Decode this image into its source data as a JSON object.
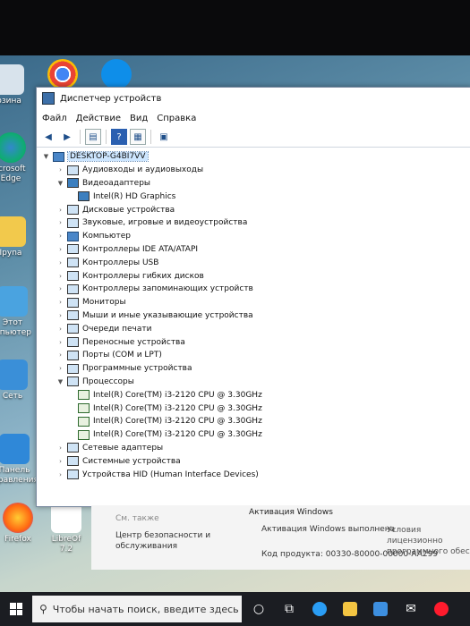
{
  "desktop": {
    "icons": [
      {
        "label": "рзина"
      },
      {
        "label": "icrosoft Edge"
      },
      {
        "label": "Ipyna"
      },
      {
        "label": "Этот мпьютер"
      },
      {
        "label": "Сеть"
      },
      {
        "label": "Панель правления"
      },
      {
        "label": "Firefox"
      },
      {
        "label": "LibreOf 7.2"
      }
    ]
  },
  "window": {
    "title": "Диспетчер устройств",
    "menu": [
      "Файл",
      "Действие",
      "Вид",
      "Справка"
    ],
    "tree": {
      "root": "DESKTOP-G4BI7VV",
      "items": [
        {
          "label": "Аудиовходы и аудиовыходы"
        },
        {
          "label": "Видеоадаптеры",
          "children": [
            "Intel(R) HD Graphics"
          ]
        },
        {
          "label": "Дисковые устройства"
        },
        {
          "label": "Звуковые, игровые и видеоустройства"
        },
        {
          "label": "Компьютер"
        },
        {
          "label": "Контроллеры IDE ATA/ATAPI"
        },
        {
          "label": "Контроллеры USB"
        },
        {
          "label": "Контроллеры гибких дисков"
        },
        {
          "label": "Контроллеры запоминающих устройств"
        },
        {
          "label": "Мониторы"
        },
        {
          "label": "Мыши и иные указывающие устройства"
        },
        {
          "label": "Очереди печати"
        },
        {
          "label": "Переносные устройства"
        },
        {
          "label": "Порты (COM и LPT)"
        },
        {
          "label": "Программные устройства"
        },
        {
          "label": "Процессоры",
          "children": [
            "Intel(R) Core(TM) i3-2120 CPU @ 3.30GHz",
            "Intel(R) Core(TM) i3-2120 CPU @ 3.30GHz",
            "Intel(R) Core(TM) i3-2120 CPU @ 3.30GHz",
            "Intel(R) Core(TM) i3-2120 CPU @ 3.30GHz"
          ]
        },
        {
          "label": "Сетевые адаптеры"
        },
        {
          "label": "Системные устройства"
        },
        {
          "label": "Устройства HID (Human Interface Devices)"
        }
      ]
    }
  },
  "system": {
    "see_also": "См. также",
    "security_center": "Центр безопасности и обслуживания",
    "activation_title": "Активация Windows",
    "activation_status": "Активация Windows выполнена",
    "license_terms": "Условия лицензионно программного обесп",
    "product_key": "Код продукта: 00330-80000-00000-AA299"
  },
  "taskbar": {
    "search_placeholder": "Чтобы начать поиск, введите здесь"
  }
}
